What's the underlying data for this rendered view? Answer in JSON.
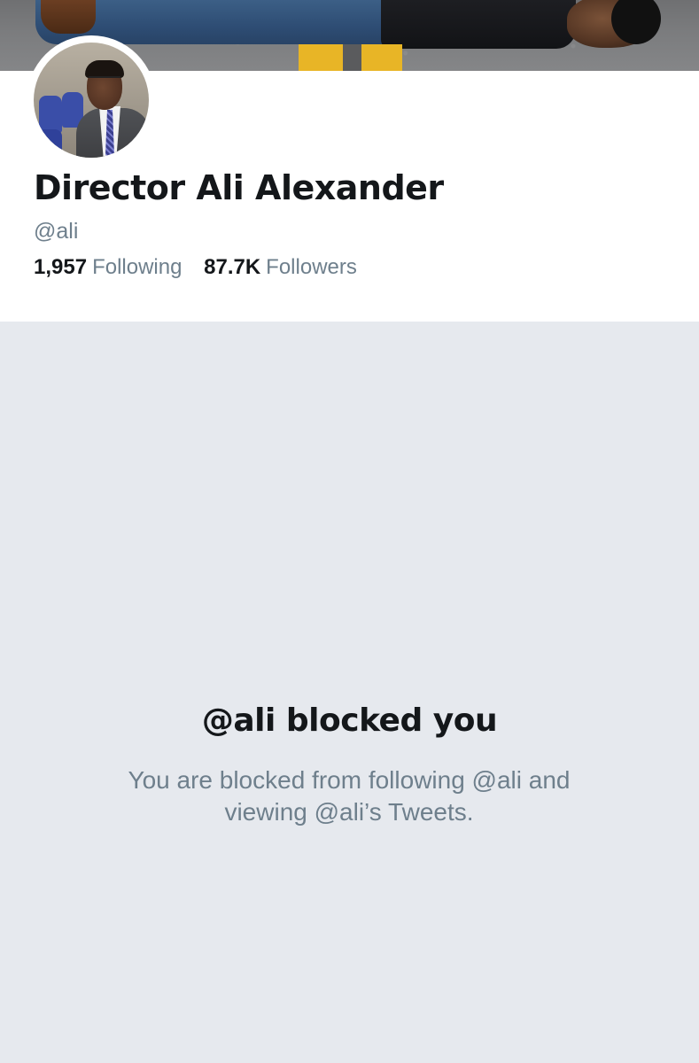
{
  "profile": {
    "display_name": "Director Ali Alexander",
    "handle": "@ali",
    "following_count": "1,957",
    "following_label": "Following",
    "followers_count": "87.7K",
    "followers_label": "Followers"
  },
  "blocked_notice": {
    "title": "@ali blocked you",
    "description": "You are blocked from following @ali and viewing @ali’s Tweets."
  },
  "colors": {
    "primary_text": "#14171a",
    "secondary_text": "#6e7f8c",
    "page_background": "#e6e9ee",
    "card_background": "#ffffff",
    "road_line_yellow": "#e8b526"
  }
}
